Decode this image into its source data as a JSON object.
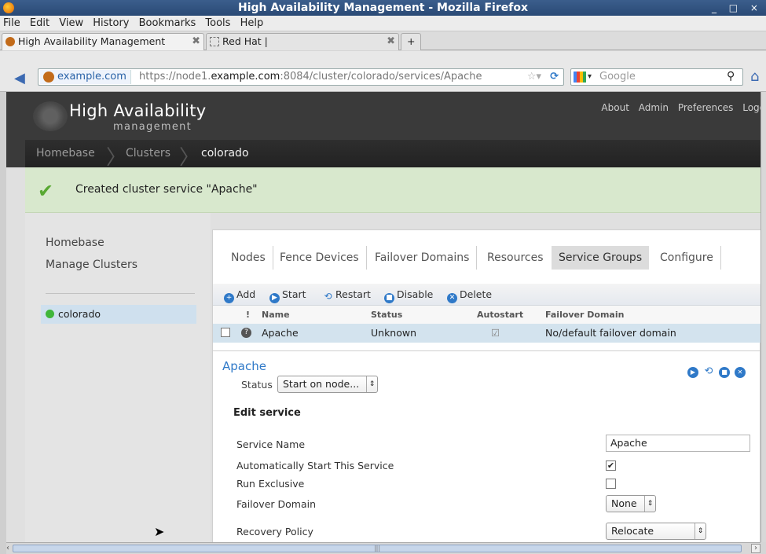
{
  "window": {
    "title": "High Availability Management - Mozilla Firefox",
    "controls": "_ □ ×"
  },
  "menu": [
    "File",
    "Edit",
    "View",
    "History",
    "Bookmarks",
    "Tools",
    "Help"
  ],
  "browser_tabs": [
    {
      "label": "High Availability Management",
      "close": "✖"
    },
    {
      "label": "Red Hat |",
      "close": "✖"
    }
  ],
  "new_tab": "+",
  "navbar": {
    "site": "example.com",
    "url_prefix": "https://node1.",
    "url_domain": "example.com",
    "url_rest": ":8084/cluster/colorado/services/Apache",
    "search_placeholder": "Google"
  },
  "header": {
    "title": "High Availability",
    "subtitle": "management",
    "links": [
      "About",
      "Admin",
      "Preferences",
      "Logo"
    ]
  },
  "breadcrumb": [
    "Homebase",
    "Clusters",
    "colorado"
  ],
  "flash": {
    "message": "Created cluster service \"Apache\""
  },
  "left": {
    "links": [
      "Homebase",
      "Manage Clusters"
    ],
    "cluster": "colorado",
    "cluster_status_color": "#3fb63a"
  },
  "service_tabs": [
    "Nodes",
    "Fence Devices",
    "Failover Domains",
    "Resources",
    "Service Groups",
    "Configure"
  ],
  "active_tab": "Service Groups",
  "toolbar": [
    "Add",
    "Start",
    "Restart",
    "Disable",
    "Delete"
  ],
  "table": {
    "headers": [
      "!",
      "Name",
      "Status",
      "Autostart",
      "Failover Domain"
    ],
    "rows": [
      {
        "name": "Apache",
        "status": "Unknown",
        "autostart": "☑",
        "failover": "No/default failover domain"
      }
    ]
  },
  "detail": {
    "service_name": "Apache",
    "status_label": "Status",
    "status_select": "Start on node...",
    "edit_title": "Edit service",
    "fields": {
      "name_label": "Service Name",
      "name_value": "Apache",
      "autostart_label": "Automatically Start This Service",
      "autostart_checked": "✔",
      "exclusive_label": "Run Exclusive",
      "domain_label": "Failover Domain",
      "domain_value": "None",
      "recovery_label": "Recovery Policy",
      "recovery_value": "Relocate"
    }
  },
  "colors": {
    "accent": "#2f79c8",
    "header_bg": "#3a3a3a",
    "flash_bg": "#d8e8cd",
    "selected_row": "#d3e3ee"
  }
}
